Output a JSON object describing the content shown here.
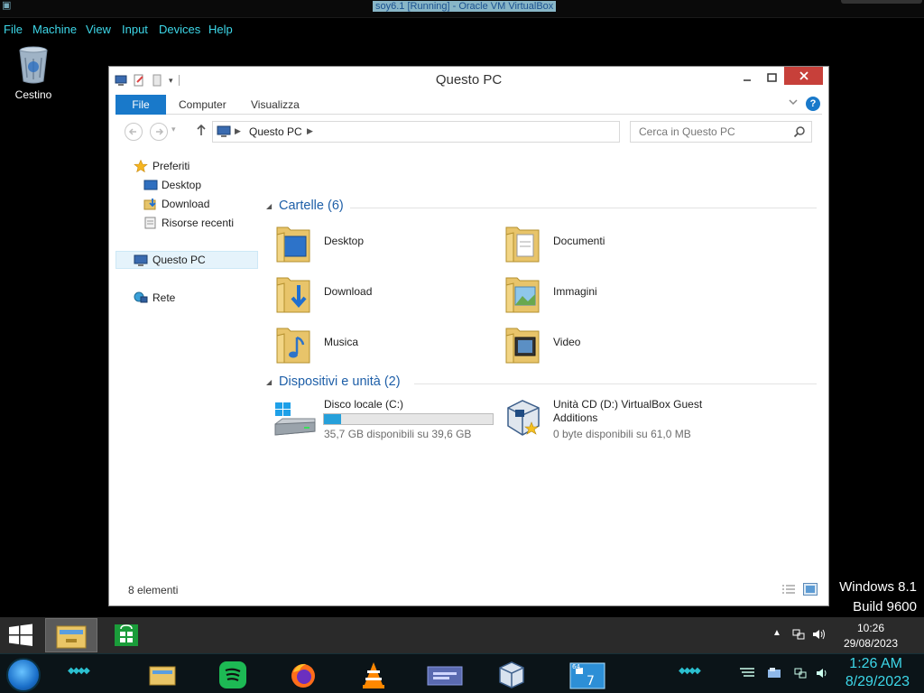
{
  "vbox": {
    "title": "soy6.1 [Running] - Oracle VM VirtualBox",
    "menu": [
      "File",
      "Machine",
      "View",
      "Input",
      "Devices",
      "Help"
    ]
  },
  "desktop": {
    "recycle_label": "Cestino",
    "watermark_os": "Windows 8.1",
    "watermark_build": "Build 9600"
  },
  "explorer": {
    "title": "Questo PC",
    "ribbon_tabs": {
      "file": "File",
      "computer": "Computer",
      "view": "Visualizza"
    },
    "help_glyph": "?",
    "address": "Questo PC",
    "search_placeholder": "Cerca in Questo PC",
    "nav": {
      "favorites": "Preferiti",
      "desktop": "Desktop",
      "download": "Download",
      "recent": "Risorse recenti",
      "thispc": "Questo PC",
      "network": "Rete"
    },
    "folders_group": "Cartelle (6)",
    "folders": [
      "Desktop",
      "Documenti",
      "Download",
      "Immagini",
      "Musica",
      "Video"
    ],
    "devices_group": "Dispositivi e unità (2)",
    "drives": [
      {
        "name": "Disco locale (C:)",
        "free": "35,7 GB disponibili su 39,6 GB",
        "used_fraction": 0.1
      },
      {
        "name": "Unità CD (D:) VirtualBox Guest Additions",
        "free": "0 byte disponibili su 61,0 MB"
      }
    ],
    "status": "8 elementi"
  },
  "guest_taskbar": {
    "time": "10:26",
    "date": "29/08/2023"
  },
  "host_taskbar": {
    "time": "1:26 AM",
    "date": "8/29/2023"
  },
  "colors": {
    "accent": "#1979ca",
    "group_title": "#1e5fa8",
    "close": "#c7403a",
    "host_accent": "#3dd7e8",
    "drive_fill": "#26a0da"
  }
}
